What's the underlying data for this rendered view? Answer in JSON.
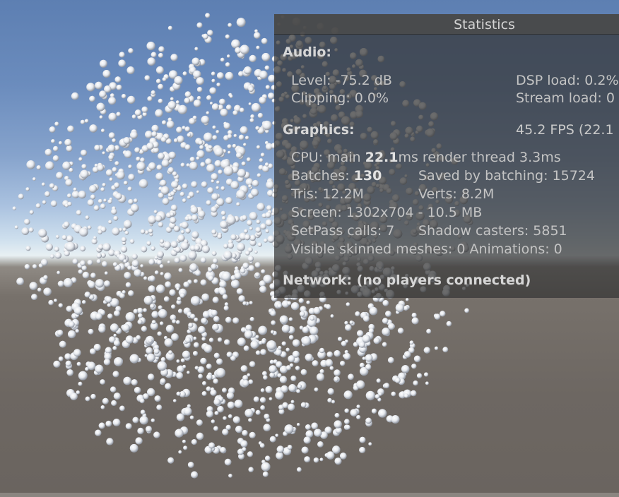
{
  "window": {
    "title": "Statistics"
  },
  "audio": {
    "header": "Audio:",
    "level": "Level: -75.2 dB",
    "clipping": "Clipping: 0.0%",
    "dsp_load": "DSP load: 0.2%",
    "stream_load": "Stream load: 0"
  },
  "graphics": {
    "header": "Graphics:",
    "fps": "45.2 FPS (22.1",
    "cpu_prefix": "CPU: main ",
    "cpu_main": "22.1",
    "cpu_suffix": "ms  render thread 3.3ms",
    "batches_prefix": "Batches: ",
    "batches": "130",
    "saved_by_batching": "Saved by batching: 15724",
    "tris": "Tris: 12.2M",
    "verts": "Verts: 8.2M",
    "screen": "Screen: 1302x704 - 10.5 MB",
    "setpass": "SetPass calls: 7",
    "shadow_casters": "Shadow casters: 5851",
    "skinned": "Visible skinned meshes: 0  Animations: 0"
  },
  "network": {
    "header": "Network: (no players connected)"
  },
  "colors": {
    "panel_bg": "#343434",
    "text": "#c4c4c4",
    "particle": "#f2f4f7"
  }
}
